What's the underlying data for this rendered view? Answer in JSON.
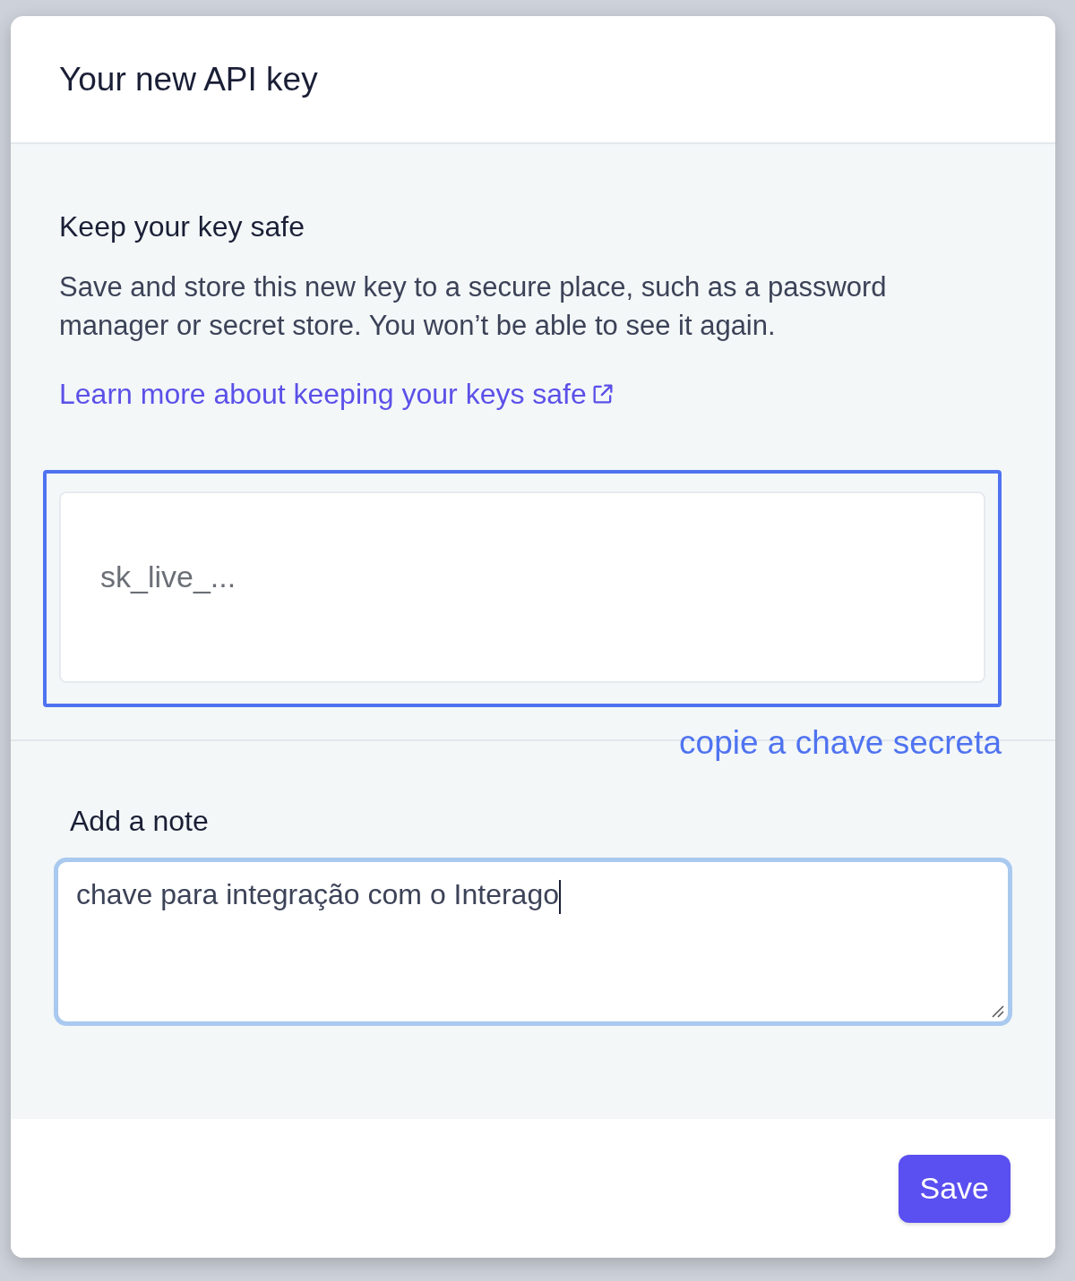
{
  "dialog": {
    "title": "Your new API key"
  },
  "key_section": {
    "heading": "Keep your key safe",
    "text": "Save and store this new key to a secure place, such as a password manager or secret store. You won’t be able to see it again.",
    "link": "Learn more about keeping your keys safe",
    "key_value": "sk_live_...",
    "highlighted": true,
    "annotation": "copie a chave secreta"
  },
  "note_section": {
    "label": "Add a note",
    "value": "chave para integração com o Interago",
    "focused": true
  },
  "buttons": [
    {
      "label": "Save",
      "kind": "primary"
    }
  ]
}
